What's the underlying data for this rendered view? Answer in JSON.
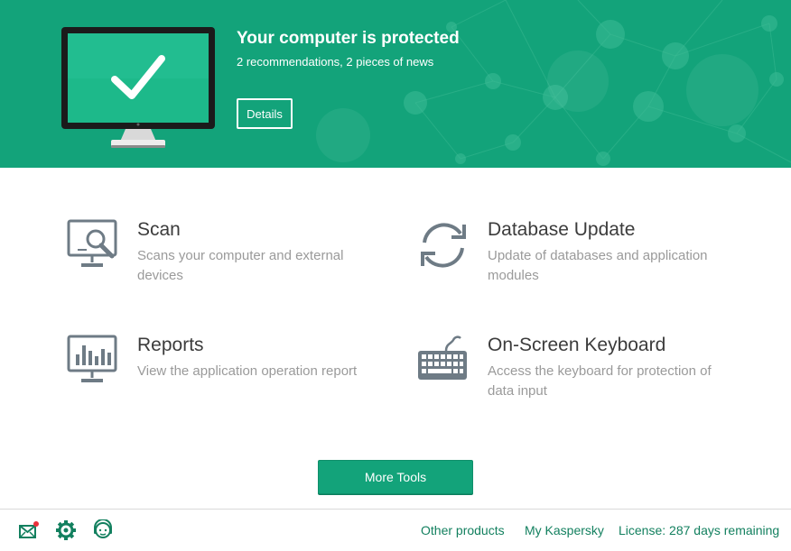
{
  "status": {
    "title": "Your computer is protected",
    "subtitle": "2 recommendations, 2 pieces of news",
    "details_label": "Details"
  },
  "tools": [
    {
      "title": "Scan",
      "description": "Scans your computer and external devices",
      "icon": "scan-monitor-icon"
    },
    {
      "title": "Database Update",
      "description": "Update of databases and application modules",
      "icon": "refresh-icon"
    },
    {
      "title": "Reports",
      "description": "View the application operation report",
      "icon": "reports-monitor-icon"
    },
    {
      "title": "On-Screen Keyboard",
      "description": "Access the keyboard for protection of data input",
      "icon": "keyboard-icon"
    }
  ],
  "more_tools_label": "More Tools",
  "footer": {
    "icons": [
      "mail-icon",
      "gear-icon",
      "support-icon"
    ],
    "links": {
      "other_products": "Other products",
      "my_kaspersky": "My Kaspersky",
      "license": "License: 287 days remaining"
    }
  },
  "colors": {
    "brand_green": "#13a37a",
    "link_green": "#13805f",
    "notification_red": "#e8323c"
  }
}
